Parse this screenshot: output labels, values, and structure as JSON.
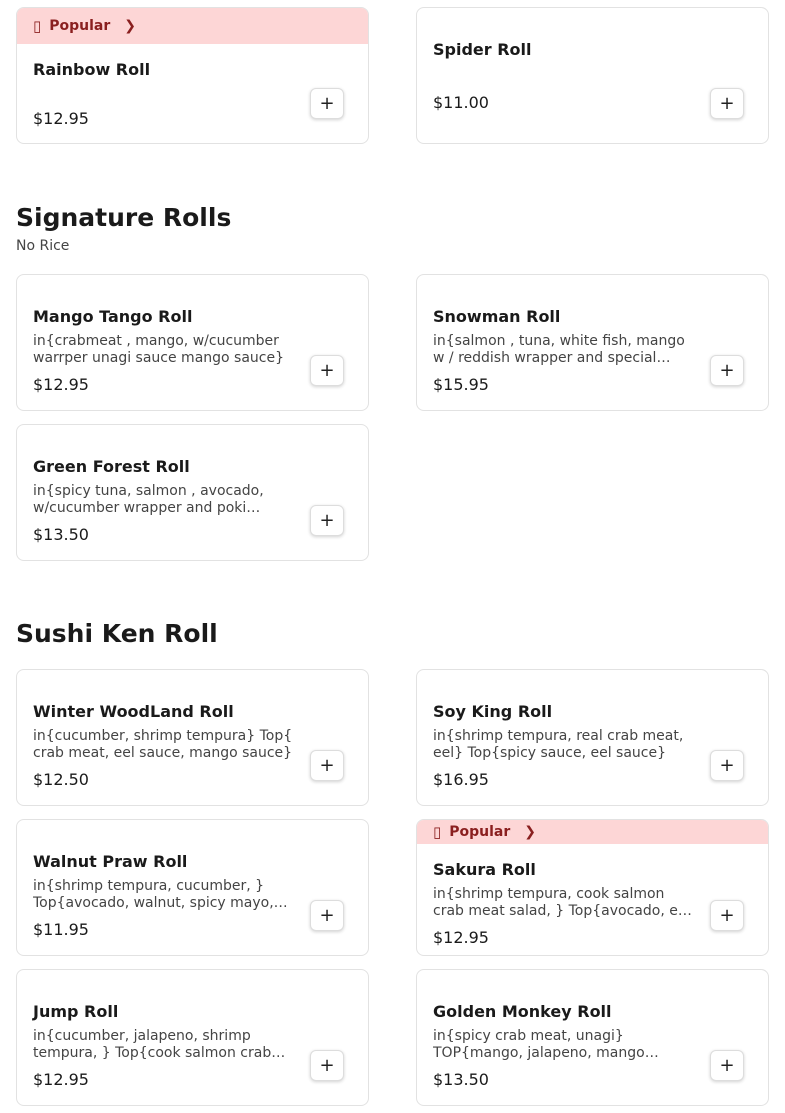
{
  "top": {
    "cards": [
      {
        "badge": "Popular",
        "name": "Rainbow Roll",
        "price": "$12.95"
      },
      {
        "name": "Spider Roll",
        "price": "$11.00"
      }
    ]
  },
  "signature": {
    "title": "Signature Rolls",
    "subtitle": "No Rice",
    "cards": [
      {
        "name": "Mango Tango Roll",
        "desc": "in{crabmeat , mango, w/cucumber warrper unagi sauce mango sauce}",
        "price": "$12.95"
      },
      {
        "name": "Snowman Roll",
        "desc": "in{salmon , tuna, white fish, mango w / reddish wrapper and special sauce}",
        "price": "$15.95"
      },
      {
        "name": "Green Forest Roll",
        "desc": "in{spicy tuna, salmon , avocado, w/cucumber wrapper and poki sauce}",
        "price": "$13.50"
      }
    ]
  },
  "ken": {
    "title": "Sushi Ken Roll",
    "cards": [
      {
        "name": "Winter WoodLand Roll",
        "desc": "in{cucumber, shrimp tempura} Top{ crab meat, eel sauce, mango sauce}",
        "price": "$12.50"
      },
      {
        "name": "Soy King Roll",
        "desc": "in{shrimp tempura, real crab meat, eel} Top{spicy sauce, eel sauce}",
        "price": "$16.95"
      },
      {
        "name": "Walnut Praw Roll",
        "desc": "in{shrimp tempura, cucumber, } Top{avocado, walnut, spicy mayo, eel sauce}",
        "price": "$11.95"
      },
      {
        "badge": "Popular",
        "name": "Sakura Roll",
        "desc": "in{shrimp tempura, cook salmon crab meat salad, } Top{avocado, eel sauce}",
        "price": "$12.95"
      },
      {
        "name": "Jump Roll",
        "desc": "in{cucumber, jalapeno, shrimp tempura, } Top{cook salmon crab meat}",
        "price": "$12.95"
      },
      {
        "name": "Golden Monkey Roll",
        "desc": "in{spicy crab meat, unagi} TOP{mango, jalapeno, mango sauce}",
        "price": "$13.50"
      }
    ]
  },
  "icons": {
    "badge": "fire-icon",
    "chevron": "chevron-right-icon",
    "add": "plus-icon"
  },
  "add_symbol": "+",
  "colors": {
    "badge_bg": "#fdd6d6",
    "badge_text": "#8a1f1f"
  }
}
